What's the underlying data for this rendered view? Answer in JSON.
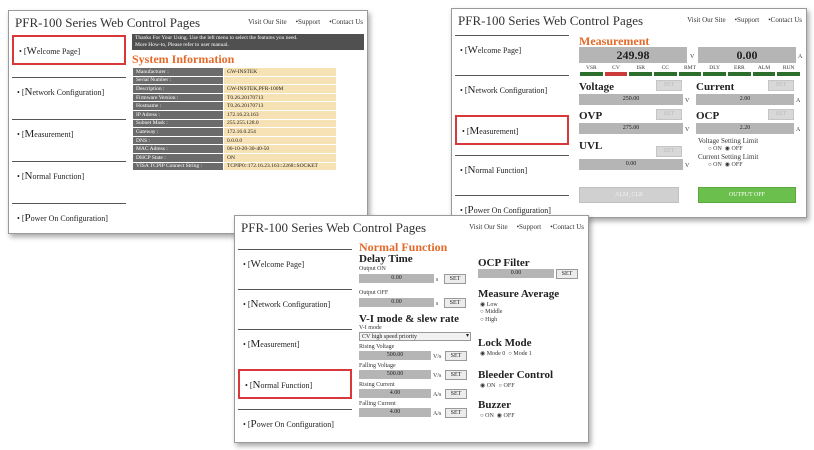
{
  "header": {
    "title": "PFR-100 Series Web Control Pages",
    "visit": "Visit Our Site",
    "support": "•Support",
    "contact": "•Contact Us"
  },
  "nav": {
    "bullet": "•",
    "bracket_open": "[",
    "bracket_close": "]",
    "items": [
      {
        "first": "W",
        "rest": "elcome Page"
      },
      {
        "first": "N",
        "rest": "etwork Configuration"
      },
      {
        "first": "M",
        "rest": "easurement"
      },
      {
        "first": "N",
        "rest": "ormal Function"
      },
      {
        "first": "P",
        "rest": "ower On Configuration"
      }
    ]
  },
  "welcome": {
    "notice_line1": "Thanks For Your Using. Use the left menu to select the features you need.",
    "notice_line2": "More How-to, Please refer to user manual.",
    "section_title": "System Information",
    "rows": [
      {
        "k": "Manufacturer :",
        "v": "GW-INSTEK"
      },
      {
        "k": "Serial Number :",
        "v": ""
      },
      {
        "k": "Description :",
        "v": "GW-INSTEK,PFR-100M"
      },
      {
        "k": "Firmware Version :",
        "v": "T0.26.20170713"
      },
      {
        "k": "Hostname :",
        "v": "T0.26.20170713"
      },
      {
        "k": "IP Adress :",
        "v": "172.16.23.163"
      },
      {
        "k": "Subnet Mask :",
        "v": "255.255.128.0"
      },
      {
        "k": "Gateway :",
        "v": "172.16.0.254"
      },
      {
        "k": "DNS :",
        "v": "0.0.0.0"
      },
      {
        "k": "MAC Adress :",
        "v": "00-10-20-30-40-50"
      },
      {
        "k": "DHCP State :",
        "v": "ON"
      },
      {
        "k": "VISA TCPIP Connect String :",
        "v": "TCPIP0::172.16.23.163::2268::SOCKET"
      }
    ]
  },
  "measurement": {
    "title": "Measurement",
    "voltage_reading": "249.98",
    "voltage_unit": "V",
    "current_reading": "0.00",
    "current_unit": "A",
    "status_labels": [
      "VSR",
      "CV",
      "ISR",
      "CC",
      "RMT",
      "DLY",
      "ERR",
      "ALM",
      "RUN"
    ],
    "status_colors": [
      "#2c6e2c",
      "#cc3b3b",
      "#2c6e2c",
      "#2c6e2c",
      "#2c6e2c",
      "#2c6e2c",
      "#2c6e2c",
      "#2c6e2c",
      "#2c6e2c"
    ],
    "voltage_label": "Voltage",
    "voltage_value": "250.00",
    "current_label": "Current",
    "current_value": "2.00",
    "ovp_label": "OVP",
    "ovp_value": "275.00",
    "ocp_label": "OCP",
    "ocp_value": "2.20",
    "uvl_label": "UVL",
    "uvl_value": "0.00",
    "set_label": "SET",
    "v_unit": "V",
    "a_unit": "A",
    "vlimit_label": "Voltage Setting Limit",
    "climit_label": "Current Setting Limit",
    "on_label": "ON",
    "off_label": "OFF",
    "alm_clr": "ALM_CLR",
    "output_off": "OUTPUT OFF"
  },
  "normal": {
    "title": "Normal Function",
    "delay_time": "Delay Time",
    "output_on_label": "Output ON",
    "output_on_value": "0.00",
    "output_off_label": "Output OFF",
    "output_off_value": "0.00",
    "s_unit": "s",
    "set_label": "SET",
    "vi_heading": "V-I mode & slew rate",
    "vi_mode_label": "V-I mode",
    "vi_mode_value": "CV high speed priority",
    "rising_voltage_label": "Rising Voltage",
    "rising_voltage_value": "500.00",
    "falling_voltage_label": "Falling Voltage",
    "falling_voltage_value": "500.00",
    "rising_current_label": "Rising Current",
    "rising_current_value": "4.00",
    "falling_current_label": "Falling Current",
    "falling_current_value": "4.00",
    "vs_unit": "V/s",
    "as_unit": "A/s",
    "ocp_filter": "OCP Filter",
    "ocp_filter_value": "0.00",
    "measure_average": "Measure Average",
    "avg_options": [
      "Low",
      "Middle",
      "High"
    ],
    "lock_mode": "Lock Mode",
    "mode0": "Mode 0",
    "mode1": "Mode 1",
    "bleeder": "Bleeder Control",
    "buzzer": "Buzzer",
    "on_label": "ON",
    "off_label": "OFF"
  }
}
